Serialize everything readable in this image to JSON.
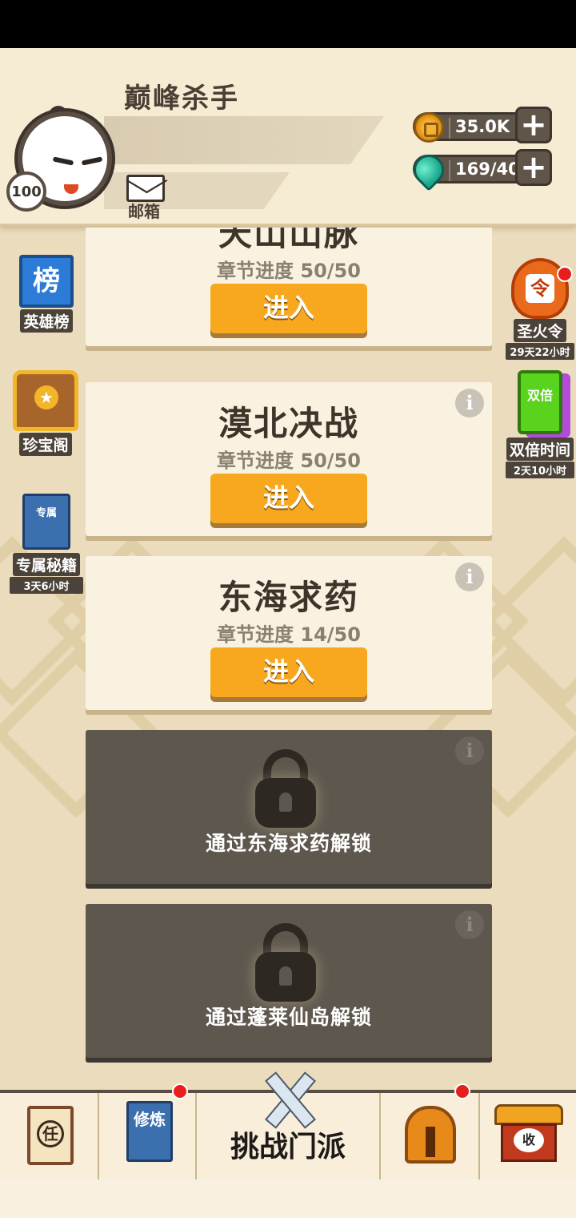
{
  "header": {
    "player_name": "巅峰杀手",
    "level": "100",
    "mail_label": "邮箱",
    "gold": "35.0K",
    "stamina": "169/40"
  },
  "side_left": {
    "ranking_label": "英雄榜",
    "ranking_icon_text": "榜",
    "treasure_label": "珍宝阁",
    "exclusive_label": "专属秘籍",
    "exclusive_icon_text": "专属",
    "exclusive_timer": "3天6小时"
  },
  "side_right": {
    "fire_order_label": "圣火令",
    "fire_order_icon_text": "令",
    "fire_order_timer": "29天22小时",
    "double_label": "双倍时间",
    "double_icon_text": "双倍",
    "double_timer": "2天10小时"
  },
  "chapters": [
    {
      "title": "天山山脉",
      "progress": "章节进度 50/50",
      "button": "进入"
    },
    {
      "title": "漠北决战",
      "progress": "章节进度 50/50",
      "button": "进入"
    },
    {
      "title": "东海求药",
      "progress": "章节进度 14/50",
      "button": "进入"
    }
  ],
  "locked": [
    {
      "text": "通过东海求药解锁"
    },
    {
      "text": "通过蓬莱仙岛解锁"
    }
  ],
  "info_glyph": "i",
  "bottom_nav": {
    "task_icon_text": "任",
    "cultivate_icon_text": "修炼",
    "challenge_label": "挑战门派",
    "collect_icon_text": "收"
  },
  "colors": {
    "accent_button": "#f7a81e",
    "badge_red": "#e81e1e",
    "locked_card": "#5e574e"
  }
}
